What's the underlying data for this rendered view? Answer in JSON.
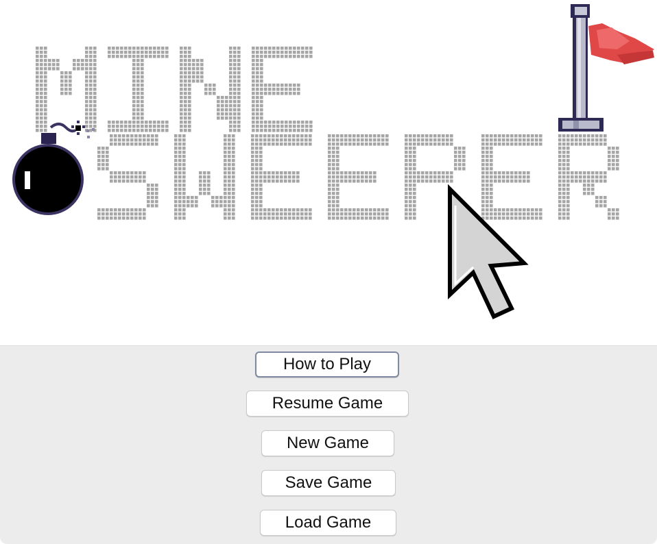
{
  "logo": {
    "line1": "MINE",
    "line2": "SWEEPER",
    "pixel_color": "#a6a6a6",
    "pixel_gap_color": "#ffffff",
    "bomb_color": "#000000",
    "bomb_outline_color": "#3b3463",
    "flag_color": "#e04848",
    "pole_color": "#b9bbcc",
    "pole_outline_color": "#2f2a55"
  },
  "cursor_icon": "arrow-cursor-icon",
  "menu": {
    "buttons": [
      {
        "id": "how-to-play",
        "label": "How to Play",
        "focused": true
      },
      {
        "id": "resume-game",
        "label": "Resume Game",
        "focused": false
      },
      {
        "id": "new-game",
        "label": "New Game",
        "focused": false
      },
      {
        "id": "save-game",
        "label": "Save Game",
        "focused": false
      },
      {
        "id": "load-game",
        "label": "Load Game",
        "focused": false
      }
    ]
  },
  "colors": {
    "menu_background": "#ececec",
    "button_background": "#ffffff",
    "focus_ring": "#7d8aa1"
  }
}
